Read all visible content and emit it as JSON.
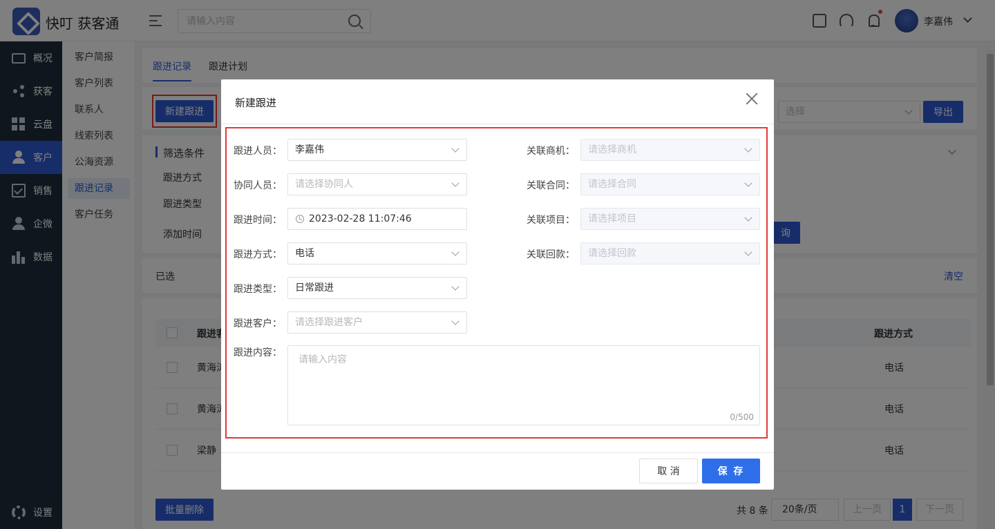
{
  "app": {
    "brand": "快叮 获客通"
  },
  "header": {
    "search_placeholder": "请输入内容",
    "user_name": "李嘉伟"
  },
  "sidenav": {
    "items": [
      "概况",
      "获客",
      "云盘",
      "客户",
      "销售",
      "企微",
      "数据"
    ],
    "settings": "设置"
  },
  "subnav": {
    "items": [
      "客户简报",
      "客户列表",
      "联系人",
      "线索列表",
      "公海资源",
      "跟进记录",
      "客户任务"
    ]
  },
  "tabs": [
    "跟进记录",
    "跟进计划"
  ],
  "toolbar": {
    "new_button": "新建跟进",
    "select_placeholder": "选择",
    "export_button": "导出"
  },
  "filter": {
    "title": "筛选条件",
    "rows": [
      "跟进方式",
      "跟进类型",
      "添加时间"
    ],
    "query_button": "询"
  },
  "selected": {
    "label": "已选",
    "clear": "清空"
  },
  "table": {
    "columns": [
      "跟进客",
      "跟进方式"
    ],
    "rows": [
      {
        "customer": "黄海涛",
        "method": "电话"
      },
      {
        "customer": "黄海涛",
        "method": "电话"
      },
      {
        "customer": "梁静",
        "method": "电话"
      }
    ]
  },
  "footer": {
    "batch_delete": "批量删除",
    "total": "共 8 条",
    "page_size": "20条/页",
    "prev": "上一页",
    "current_page": "1",
    "next": "下一页"
  },
  "modal": {
    "title": "新建跟进",
    "left_fields": [
      {
        "label": "跟进人员：",
        "value": "李嘉伟",
        "placeholder": false
      },
      {
        "label": "协同人员：",
        "value": "请选择协同人",
        "placeholder": true
      },
      {
        "label": "跟进时间：",
        "value": "2023-02-28 11:07:46",
        "placeholder": false
      },
      {
        "label": "跟进方式：",
        "value": "电话",
        "placeholder": false
      },
      {
        "label": "跟进类型：",
        "value": "日常跟进",
        "placeholder": false
      },
      {
        "label": "跟进客户：",
        "value": "请选择跟进客户",
        "placeholder": true
      }
    ],
    "right_fields": [
      {
        "label": "关联商机：",
        "placeholder": "请选择商机"
      },
      {
        "label": "关联合同：",
        "placeholder": "请选择合同"
      },
      {
        "label": "关联项目：",
        "placeholder": "请选择项目"
      },
      {
        "label": "关联回款：",
        "placeholder": "请选择回款"
      }
    ],
    "content_label": "跟进内容：",
    "content_placeholder": "请输入内容",
    "content_counter": "0/500",
    "cancel": "取 消",
    "save": "保 存"
  },
  "colors": {
    "primary": "#2e5bd4",
    "save": "#2e6ee8",
    "highlight": "#e53935",
    "sidenav_bg": "#1f2d3d"
  }
}
